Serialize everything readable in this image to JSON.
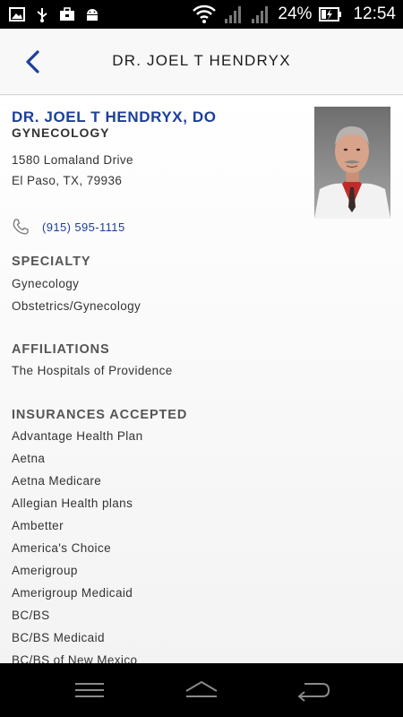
{
  "status_bar": {
    "battery_percent": "24%",
    "time": "12:54",
    "icons": [
      "image-icon",
      "usb-icon",
      "briefcase-icon",
      "android-icon",
      "wifi-icon",
      "signal-icon",
      "signal-icon",
      "battery-charging-icon"
    ]
  },
  "header": {
    "title": "DR. JOEL T HENDRYX",
    "back_icon": "chevron-left-icon"
  },
  "doctor": {
    "name": "DR. JOEL T HENDRYX, DO",
    "specialty": "GYNECOLOGY",
    "address_line1": "1580 Lomaland Drive",
    "address_line2": "El Paso, TX, 79936",
    "phone": "(915) 595-1115"
  },
  "sections": {
    "specialty": {
      "title": "SPECIALTY",
      "items": [
        "Gynecology",
        "Obstetrics/Gynecology"
      ]
    },
    "affiliations": {
      "title": "AFFILIATIONS",
      "items": [
        "The Hospitals of Providence"
      ]
    },
    "insurances": {
      "title": "INSURANCES ACCEPTED",
      "items": [
        "Advantage Health Plan",
        "Aetna",
        "Aetna Medicare",
        "Allegian Health plans",
        "Ambetter",
        "America's Choice",
        "Amerigroup",
        "Amerigroup Medicaid",
        "BC/BS",
        "BC/BS Medicaid",
        "BC/BS of New Mexico"
      ]
    }
  },
  "colors": {
    "accent": "#1c3f9b",
    "header_bg": "#f8f8f8",
    "status_bar_bg": "#000000"
  }
}
